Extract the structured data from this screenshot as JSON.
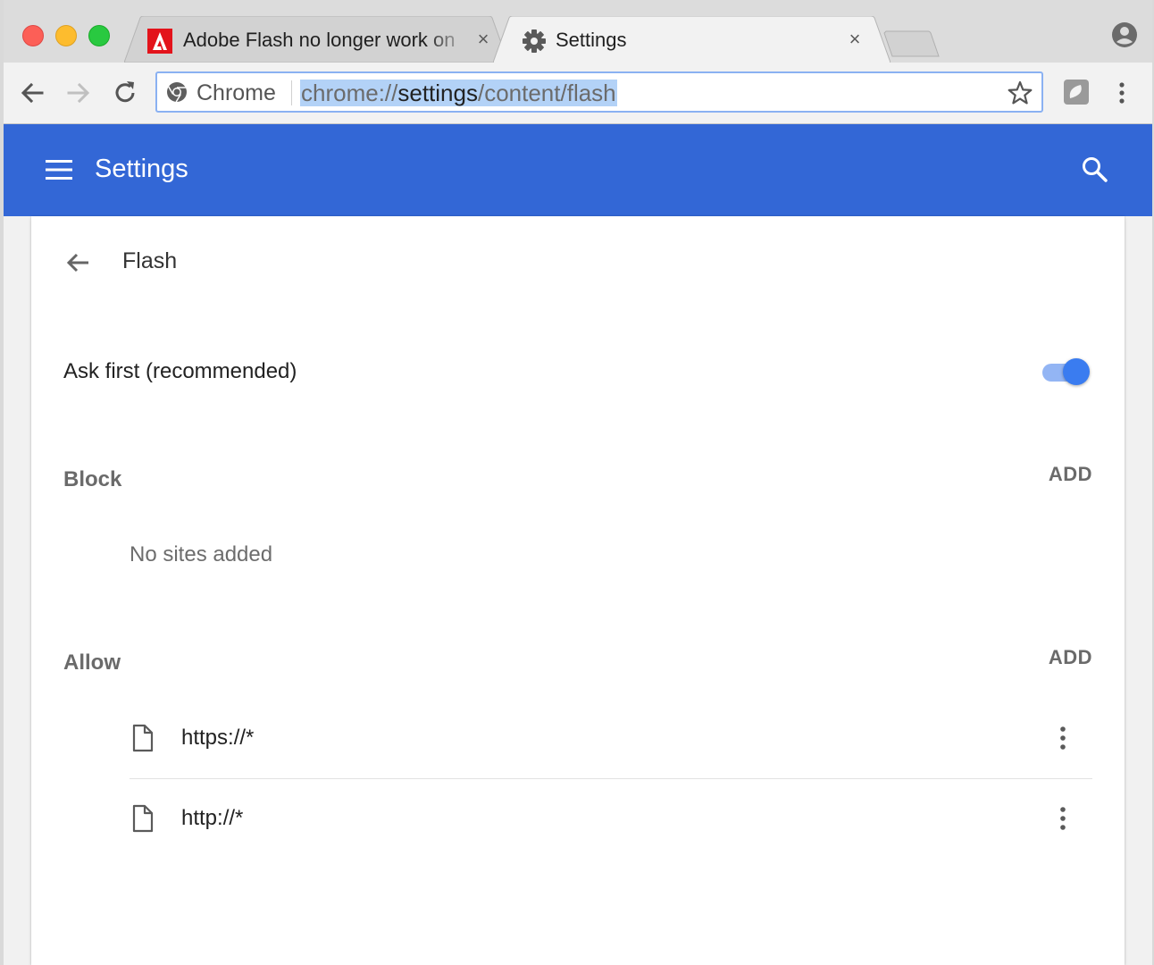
{
  "browser": {
    "tabs": [
      {
        "title": "Adobe Flash no longer work on",
        "favicon": "adobe-icon",
        "active": false
      },
      {
        "title": "Settings",
        "favicon": "gear-icon",
        "active": true
      }
    ],
    "close_glyph": "×",
    "omnibox": {
      "chip_label": "Chrome",
      "url_scheme": "chrome://",
      "url_host": "settings",
      "url_path": "/content/flash"
    }
  },
  "header": {
    "title": "Settings"
  },
  "page": {
    "subpage_title": "Flash",
    "ask_first": {
      "label": "Ask first (recommended)",
      "enabled": true
    },
    "block": {
      "label": "Block",
      "add_label": "ADD",
      "empty_text": "No sites added"
    },
    "allow": {
      "label": "Allow",
      "add_label": "ADD",
      "sites": [
        {
          "pattern": "https://*"
        },
        {
          "pattern": "http://*"
        }
      ]
    }
  },
  "colors": {
    "header": "#3367d6",
    "toggle_on": "#3a7cf0",
    "url_selection": "#b3d2f7"
  }
}
